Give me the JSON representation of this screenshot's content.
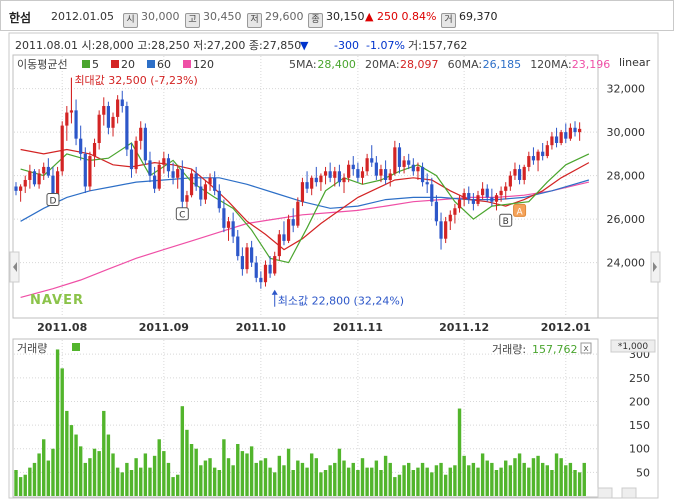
{
  "header": {
    "name": "한섬",
    "date": "2012.01.05",
    "open_badge": "시",
    "open": "30,000",
    "high_badge": "고",
    "high": "30,450",
    "low_badge": "저",
    "low": "29,600",
    "close_badge": "종",
    "close": "30,150",
    "change_arrow": "▲",
    "change": "250",
    "change_pct": "0.84%",
    "volume_badge": "거",
    "volume": "69,370"
  },
  "info_line": {
    "text": "2011.08.01 시:28,000 고:28,250 저:27,200 종:27,850",
    "arrow": "▼",
    "change": "-300",
    "change_pct": "-1.07%",
    "volume": "거:157,762"
  },
  "ma_legend": {
    "label": "이동평균선",
    "items": [
      {
        "label": "5",
        "color": "#4aa52e"
      },
      {
        "label": "20",
        "color": "#d32424"
      },
      {
        "label": "60",
        "color": "#2d6fc7"
      },
      {
        "label": "120",
        "color": "#ef4fa6"
      }
    ],
    "values": [
      {
        "label": "5MA:",
        "value": "28,400",
        "color": "#4aa52e"
      },
      {
        "label": "20MA:",
        "value": "28,097",
        "color": "#d32424"
      },
      {
        "label": "60MA:",
        "value": "26,185",
        "color": "#2d6fc7"
      },
      {
        "label": "120MA:",
        "value": "23,196",
        "color": "#ef4fa6"
      }
    ],
    "scale": "linear"
  },
  "annotations": {
    "max_label": "최대값 32,500 (-7,23%)",
    "min_label": "최소값 22,800 (32,24%)",
    "markers": [
      "D",
      "C",
      "B",
      "A"
    ],
    "watermark": "NAVER"
  },
  "volume_panel": {
    "label": "거래량",
    "right_label": "거래량:",
    "right_value": "157,762",
    "multiplier": "*1,000",
    "close_symbol": "x"
  },
  "colors": {
    "up": "#d32424",
    "down": "#2d57c9",
    "volume": "#52b52c",
    "grid": "#d8d8d8"
  },
  "chart_data": {
    "type": "candlestick",
    "price_axis": {
      "ticks": [
        24000,
        26000,
        28000,
        30000,
        32000
      ],
      "tick_labels": [
        "24,000",
        "26,000",
        "28,000",
        "30,000",
        "32,000"
      ],
      "ylim": [
        21500,
        33500
      ]
    },
    "volume_axis": {
      "ticks": [
        50,
        100,
        150,
        200,
        250,
        300
      ],
      "ylim": [
        0,
        330
      ]
    },
    "x_labels": [
      {
        "label": "2011.08",
        "index": 10
      },
      {
        "label": "2011.09",
        "index": 32
      },
      {
        "label": "2011.10",
        "index": 53
      },
      {
        "label": "2011.11",
        "index": 74
      },
      {
        "label": "2011.12",
        "index": 97
      },
      {
        "label": "2012.01",
        "index": 119
      }
    ],
    "marker_positions": [
      {
        "label": "D",
        "index": 8,
        "price": 26900
      },
      {
        "label": "C",
        "index": 36,
        "price": 26250
      },
      {
        "label": "B",
        "index": 106,
        "price": 25950
      },
      {
        "label": "A",
        "index": 109,
        "price": 26400
      }
    ],
    "max_point": {
      "index": 12,
      "price": 32500
    },
    "min_point": {
      "index": 56,
      "price": 22800
    },
    "moving_averages": {
      "ma5": [
        [
          1,
          28300
        ],
        [
          6,
          28000
        ],
        [
          11,
          29000
        ],
        [
          16,
          28700
        ],
        [
          20,
          28800
        ],
        [
          25,
          29500
        ],
        [
          29,
          28000
        ],
        [
          34,
          28700
        ],
        [
          38,
          27700
        ],
        [
          43,
          27000
        ],
        [
          47,
          26500
        ],
        [
          51,
          25500
        ],
        [
          55,
          24200
        ],
        [
          59,
          24000
        ],
        [
          63,
          25600
        ],
        [
          67,
          27300
        ],
        [
          71,
          27900
        ],
        [
          75,
          27600
        ],
        [
          79,
          27800
        ],
        [
          83,
          28200
        ],
        [
          87,
          28500
        ],
        [
          91,
          28000
        ],
        [
          95,
          26800
        ],
        [
          99,
          26000
        ],
        [
          103,
          26600
        ],
        [
          107,
          26700
        ],
        [
          111,
          26800
        ],
        [
          115,
          27700
        ],
        [
          119,
          28500
        ],
        [
          124,
          29000
        ]
      ],
      "ma20": [
        [
          1,
          29200
        ],
        [
          6,
          29000
        ],
        [
          11,
          29200
        ],
        [
          16,
          29000
        ],
        [
          21,
          28500
        ],
        [
          25,
          28400
        ],
        [
          30,
          28600
        ],
        [
          34,
          28500
        ],
        [
          38,
          28300
        ],
        [
          42,
          27600
        ],
        [
          46,
          26800
        ],
        [
          50,
          25900
        ],
        [
          54,
          25300
        ],
        [
          58,
          24600
        ],
        [
          62,
          25100
        ],
        [
          66,
          25800
        ],
        [
          70,
          26400
        ],
        [
          74,
          27000
        ],
        [
          78,
          27400
        ],
        [
          82,
          27800
        ],
        [
          86,
          27900
        ],
        [
          90,
          27800
        ],
        [
          94,
          27300
        ],
        [
          98,
          26900
        ],
        [
          102,
          26800
        ],
        [
          106,
          26600
        ],
        [
          110,
          26900
        ],
        [
          114,
          27300
        ],
        [
          118,
          27900
        ],
        [
          124,
          28600
        ]
      ],
      "ma60": [
        [
          1,
          25900
        ],
        [
          6,
          26500
        ],
        [
          11,
          27000
        ],
        [
          16,
          27300
        ],
        [
          21,
          27500
        ],
        [
          26,
          27700
        ],
        [
          32,
          27800
        ],
        [
          38,
          27900
        ],
        [
          44,
          27900
        ],
        [
          50,
          27600
        ],
        [
          56,
          27200
        ],
        [
          62,
          26800
        ],
        [
          68,
          26500
        ],
        [
          74,
          26600
        ],
        [
          80,
          26900
        ],
        [
          86,
          27000
        ],
        [
          92,
          27000
        ],
        [
          98,
          26900
        ],
        [
          104,
          26900
        ],
        [
          110,
          27000
        ],
        [
          116,
          27300
        ],
        [
          124,
          27800
        ]
      ],
      "ma120": [
        [
          1,
          22400
        ],
        [
          8,
          22800
        ],
        [
          14,
          23200
        ],
        [
          20,
          23700
        ],
        [
          26,
          24200
        ],
        [
          32,
          24600
        ],
        [
          38,
          25000
        ],
        [
          44,
          25400
        ],
        [
          50,
          25800
        ],
        [
          56,
          26000
        ],
        [
          62,
          26200
        ],
        [
          68,
          26300
        ],
        [
          74,
          26400
        ],
        [
          80,
          26600
        ],
        [
          86,
          26800
        ],
        [
          92,
          26900
        ],
        [
          98,
          27000
        ],
        [
          104,
          27000
        ],
        [
          110,
          27100
        ],
        [
          116,
          27300
        ],
        [
          124,
          27700
        ]
      ]
    },
    "candles": [
      [
        27500,
        27700,
        27100,
        27300
      ],
      [
        27300,
        27600,
        26800,
        27500
      ],
      [
        27500,
        28000,
        27200,
        27800
      ],
      [
        27800,
        28500,
        27400,
        28200
      ],
      [
        28200,
        28300,
        27500,
        27600
      ],
      [
        27600,
        28300,
        27400,
        28100
      ],
      [
        28100,
        28600,
        27800,
        28400
      ],
      [
        28400,
        28800,
        27900,
        28000
      ],
      [
        28000,
        28400,
        26700,
        27100
      ],
      [
        27100,
        28400,
        26900,
        28200
      ],
      [
        28200,
        30500,
        28000,
        30300
      ],
      [
        30300,
        31200,
        29600,
        30900
      ],
      [
        30900,
        32500,
        30400,
        31000
      ],
      [
        31000,
        31500,
        29400,
        29700
      ],
      [
        29700,
        30300,
        28700,
        29000
      ],
      [
        29000,
        29300,
        27200,
        27500
      ],
      [
        27500,
        29100,
        27300,
        28900
      ],
      [
        28900,
        29700,
        28400,
        29500
      ],
      [
        29500,
        31000,
        29200,
        30800
      ],
      [
        30800,
        31600,
        30300,
        31200
      ],
      [
        31200,
        31400,
        29900,
        30200
      ],
      [
        30200,
        30900,
        29800,
        30700
      ],
      [
        30700,
        31700,
        30400,
        31500
      ],
      [
        31500,
        31900,
        30900,
        31200
      ],
      [
        31200,
        31400,
        28900,
        29200
      ],
      [
        29200,
        29500,
        27900,
        28300
      ],
      [
        28300,
        29800,
        28100,
        29600
      ],
      [
        29600,
        30500,
        29200,
        30200
      ],
      [
        30200,
        30400,
        28500,
        28700
      ],
      [
        28700,
        29100,
        27700,
        28000
      ],
      [
        28000,
        28400,
        27200,
        27400
      ],
      [
        27400,
        28700,
        27300,
        28500
      ],
      [
        28500,
        29100,
        28100,
        28800
      ],
      [
        28800,
        29000,
        27900,
        28200
      ],
      [
        28200,
        28600,
        27600,
        27900
      ],
      [
        27900,
        28500,
        27400,
        28300
      ],
      [
        28300,
        28700,
        26500,
        26800
      ],
      [
        26800,
        27300,
        26100,
        27100
      ],
      [
        27100,
        28300,
        27000,
        28100
      ],
      [
        28100,
        28400,
        27300,
        27500
      ],
      [
        27500,
        27900,
        26600,
        26900
      ],
      [
        26900,
        27800,
        26700,
        27600
      ],
      [
        27600,
        28100,
        27300,
        27900
      ],
      [
        27900,
        28200,
        27100,
        27300
      ],
      [
        27300,
        27600,
        26300,
        26500
      ],
      [
        26500,
        26900,
        25400,
        25600
      ],
      [
        25600,
        26100,
        25000,
        25900
      ],
      [
        25900,
        26300,
        24900,
        25200
      ],
      [
        25200,
        25500,
        24100,
        24300
      ],
      [
        24300,
        24700,
        23400,
        23700
      ],
      [
        23700,
        24900,
        23500,
        24700
      ],
      [
        24700,
        25000,
        23800,
        24000
      ],
      [
        24000,
        24300,
        23100,
        23300
      ],
      [
        23300,
        23600,
        22800,
        23100
      ],
      [
        23100,
        24100,
        22900,
        23900
      ],
      [
        23900,
        24300,
        23300,
        23500
      ],
      [
        23500,
        24500,
        23400,
        24300
      ],
      [
        24300,
        25500,
        24100,
        25300
      ],
      [
        25300,
        25900,
        24800,
        25000
      ],
      [
        25000,
        26200,
        24900,
        26000
      ],
      [
        26000,
        26500,
        25400,
        25700
      ],
      [
        25700,
        27000,
        25600,
        26800
      ],
      [
        26800,
        27900,
        26600,
        27700
      ],
      [
        27700,
        28200,
        27200,
        27400
      ],
      [
        27400,
        28000,
        27100,
        27900
      ],
      [
        27900,
        28400,
        27500,
        27700
      ],
      [
        27700,
        28100,
        27300,
        28000
      ],
      [
        28000,
        28400,
        27600,
        28200
      ],
      [
        28200,
        28600,
        27700,
        27900
      ],
      [
        27900,
        28400,
        27500,
        28200
      ],
      [
        28200,
        28500,
        27500,
        27700
      ],
      [
        27700,
        28100,
        27200,
        27900
      ],
      [
        27900,
        28700,
        27700,
        28500
      ],
      [
        28500,
        28900,
        28000,
        28300
      ],
      [
        28300,
        28600,
        27700,
        27900
      ],
      [
        27900,
        28400,
        27600,
        28200
      ],
      [
        28200,
        29000,
        28000,
        28800
      ],
      [
        28800,
        29400,
        28400,
        28600
      ],
      [
        28600,
        28900,
        27800,
        28000
      ],
      [
        28000,
        28500,
        27700,
        28300
      ],
      [
        28300,
        28700,
        27600,
        27800
      ],
      [
        27800,
        28300,
        27500,
        28100
      ],
      [
        28100,
        29600,
        28000,
        29300
      ],
      [
        29300,
        29500,
        28100,
        28400
      ],
      [
        28400,
        28900,
        28100,
        28700
      ],
      [
        28700,
        29000,
        28300,
        28500
      ],
      [
        28500,
        28800,
        28000,
        28200
      ],
      [
        28200,
        28600,
        27800,
        28400
      ],
      [
        28400,
        28600,
        27500,
        27700
      ],
      [
        27700,
        28100,
        27200,
        27600
      ],
      [
        27600,
        27900,
        26600,
        26800
      ],
      [
        26800,
        27100,
        25700,
        25900
      ],
      [
        25900,
        26300,
        24600,
        25100
      ],
      [
        25100,
        26100,
        24900,
        25900
      ],
      [
        25900,
        26400,
        25500,
        26200
      ],
      [
        26200,
        26700,
        25800,
        26500
      ],
      [
        26500,
        27100,
        26300,
        26900
      ],
      [
        26900,
        27400,
        26600,
        27200
      ],
      [
        27200,
        27500,
        26700,
        26900
      ],
      [
        26900,
        27200,
        26400,
        26700
      ],
      [
        26700,
        27300,
        26600,
        27100
      ],
      [
        27100,
        27700,
        26900,
        27400
      ],
      [
        27400,
        27600,
        26800,
        27000
      ],
      [
        27000,
        27400,
        26600,
        26800
      ],
      [
        26800,
        27200,
        26400,
        27100
      ],
      [
        27100,
        27500,
        26800,
        27300
      ],
      [
        27300,
        27700,
        26900,
        27500
      ],
      [
        27500,
        28200,
        27300,
        28000
      ],
      [
        28000,
        28600,
        27800,
        28300
      ],
      [
        28300,
        28500,
        27600,
        27800
      ],
      [
        27800,
        28500,
        27600,
        28400
      ],
      [
        28400,
        29100,
        28200,
        28900
      ],
      [
        28900,
        29300,
        28500,
        28700
      ],
      [
        28700,
        29200,
        28200,
        29100
      ],
      [
        29100,
        29500,
        28700,
        28900
      ],
      [
        28900,
        29600,
        28800,
        29400
      ],
      [
        29400,
        30000,
        29200,
        29800
      ],
      [
        29800,
        30200,
        29300,
        29500
      ],
      [
        29500,
        30100,
        29400,
        30000
      ],
      [
        30000,
        30400,
        29500,
        29700
      ],
      [
        29700,
        30400,
        29600,
        30200
      ],
      [
        30200,
        30500,
        29800,
        30000
      ],
      [
        30000,
        30450,
        29600,
        30150
      ]
    ],
    "volumes": [
      55,
      40,
      45,
      60,
      70,
      90,
      120,
      75,
      100,
      310,
      270,
      180,
      150,
      130,
      105,
      70,
      80,
      100,
      95,
      180,
      130,
      90,
      60,
      50,
      70,
      55,
      80,
      60,
      90,
      60,
      85,
      120,
      95,
      70,
      40,
      45,
      190,
      140,
      110,
      100,
      65,
      75,
      80,
      60,
      55,
      120,
      80,
      65,
      110,
      95,
      90,
      105,
      70,
      75,
      80,
      60,
      50,
      85,
      65,
      100,
      55,
      75,
      70,
      60,
      90,
      80,
      50,
      55,
      65,
      70,
      100,
      75,
      60,
      70,
      55,
      80,
      60,
      60,
      75,
      55,
      85,
      70,
      40,
      45,
      65,
      70,
      55,
      60,
      70,
      60,
      50,
      65,
      70,
      45,
      60,
      65,
      185,
      85,
      65,
      70,
      60,
      90,
      75,
      70,
      55,
      60,
      75,
      65,
      80,
      90,
      70,
      60,
      80,
      85,
      70,
      65,
      55,
      90,
      80,
      65,
      70,
      55,
      50,
      70
    ]
  }
}
